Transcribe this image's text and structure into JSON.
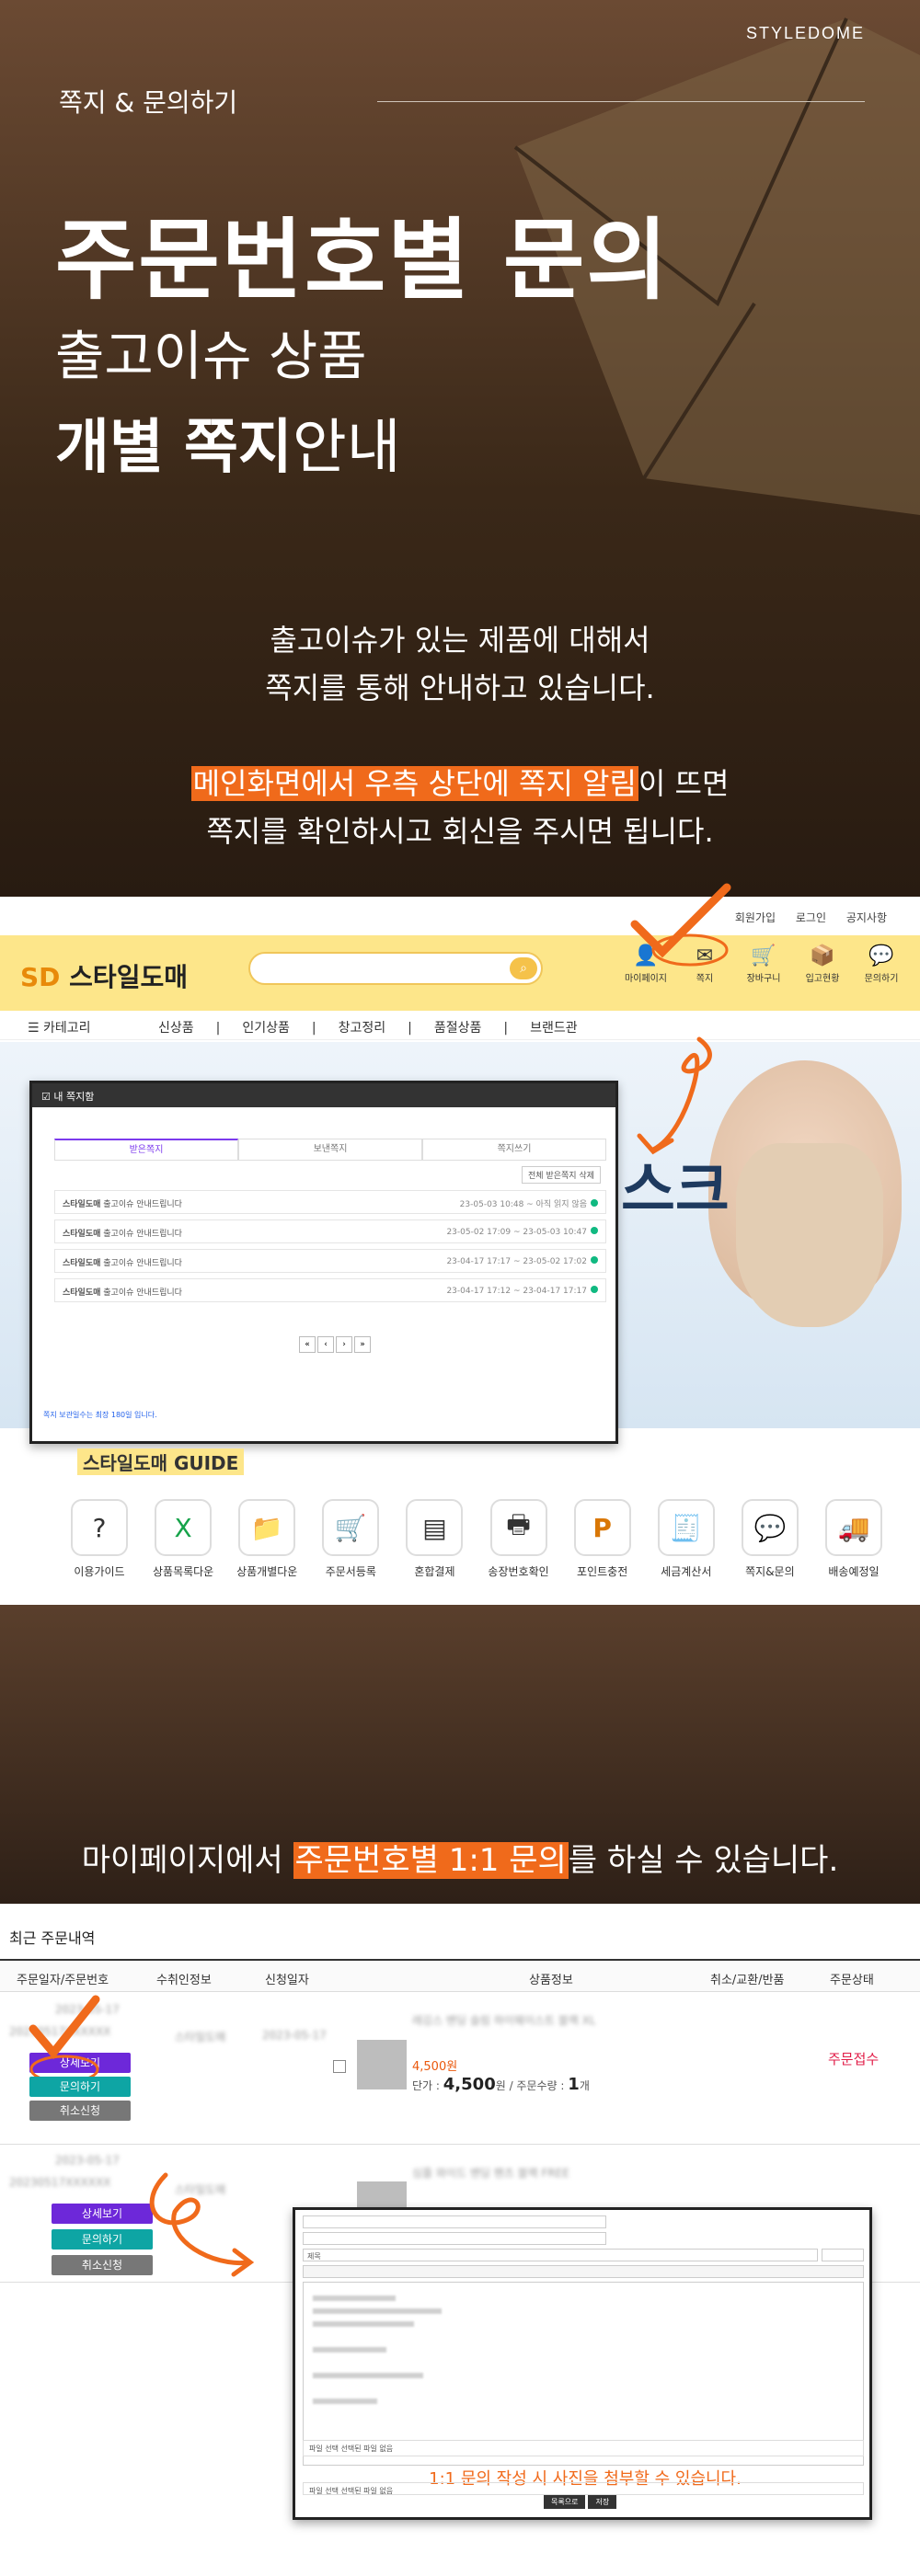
{
  "hero": {
    "brand": "STYLEDOME",
    "subheading": "쪽지 & 문의하기",
    "title": "주문번호별 문의",
    "line2": "출고이슈 상품",
    "line3_bold": "개별 쪽지",
    "line3_light": "안내",
    "desc1": "출고이슈가 있는 제품에 대해서",
    "desc2": "쪽지를 통해  안내하고 있습니다.",
    "desc3_highlight": "메인화면에서 우측 상단에 쪽지 알림",
    "desc3_rest": "이 뜨면",
    "desc4": "쪽지를 확인하시고 회신을 주시면 됩니다.",
    "accent_color": "#f06a1b"
  },
  "site": {
    "topnav": [
      "회원가입",
      "로그인",
      "공지사항"
    ],
    "logo_mark": "SD",
    "logo_text": "스타일도매",
    "header_icons": [
      {
        "icon": "user-icon",
        "glyph": "👤",
        "label": "마이페이지"
      },
      {
        "icon": "mail-icon",
        "glyph": "✉",
        "label": "쪽지"
      },
      {
        "icon": "cart-icon",
        "glyph": "🛒",
        "label": "장바구니"
      },
      {
        "icon": "box-icon",
        "glyph": "📦",
        "label": "입고현황"
      },
      {
        "icon": "chat-icon",
        "glyph": "💬",
        "label": "문의하기"
      }
    ],
    "category_label": "카테고리",
    "menu": [
      "신상품",
      "|",
      "인기상품",
      "|",
      "창고정리",
      "|",
      "품절상품",
      "|",
      "브랜드관"
    ],
    "banner_text": "스크",
    "guide_tag": "스타일도매 GUIDE",
    "guides": [
      {
        "icon": "guide-icon",
        "glyph": "?",
        "label": "이용가이드"
      },
      {
        "icon": "excel-icon",
        "glyph": "X",
        "label": "상품목록다운"
      },
      {
        "icon": "folder-icon",
        "glyph": "📁",
        "label": "상품개별다운"
      },
      {
        "icon": "cart-icon",
        "glyph": "🛒",
        "label": "주문서등록"
      },
      {
        "icon": "payment-icon",
        "glyph": "▤",
        "label": "혼합결제"
      },
      {
        "icon": "printer-icon",
        "glyph": "🖶",
        "label": "송장번호확인"
      },
      {
        "icon": "point-icon",
        "glyph": "P",
        "label": "포인트충전"
      },
      {
        "icon": "invoice-icon",
        "glyph": "🧾",
        "label": "세금계산서"
      },
      {
        "icon": "message-icon",
        "glyph": "💬",
        "label": "쪽지&문의"
      },
      {
        "icon": "delivery-icon",
        "glyph": "🚚",
        "label": "배송예정일"
      }
    ]
  },
  "modal": {
    "title": "☑ 내 쪽지함",
    "tabs": [
      "받은쪽지",
      "보낸쪽지",
      "쪽지쓰기"
    ],
    "delete_label": "전체 받은쪽지 삭제",
    "rows": [
      {
        "sender": "스타일도매",
        "msg": "출고이슈 안내드립니다",
        "date": "23-05-03 10:48 ~ 아직 읽지 않음"
      },
      {
        "sender": "스타일도매",
        "msg": "출고이슈 안내드립니다",
        "date": "23-05-02 17:09 ~ 23-05-03 10:47"
      },
      {
        "sender": "스타일도매",
        "msg": "출고이슈 안내드립니다",
        "date": "23-04-17 17:17 ~ 23-05-02 17:02"
      },
      {
        "sender": "스타일도매",
        "msg": "출고이슈 안내드립니다",
        "date": "23-04-17 17:12 ~ 23-04-17 17:17"
      }
    ],
    "pages": [
      "«",
      "‹",
      "›",
      "»"
    ],
    "footer": "쪽지 보관일수는 최장 180일 입니다."
  },
  "section2": {
    "pre": "마이페이지에서 ",
    "highlight": "주문번호별 1:1 문의",
    "post": "를 하실 수 있습니다."
  },
  "orders": {
    "title": "최근 주문내역",
    "headers": [
      "주문일자/주문번호",
      "수취인정보",
      "신청일자",
      "상품정보",
      "취소/교환/반품",
      "주문상태"
    ],
    "row1": {
      "date": "2023-05-17",
      "number": "20230517XXXXXX",
      "buttons": [
        "상세보기",
        "문의하기",
        "취소신청"
      ],
      "receiver": "스타일도매",
      "applied": "2023-05-17",
      "product": "레깅스 밴딩 슬림 하이웨이스트 블랙 XL",
      "price": "4,500원",
      "unit_label": "단가 :",
      "unit_price": "4,500",
      "unit_suffix": "원 / 주문수량 :",
      "qty": "1",
      "qty_suffix": "개",
      "status": "주문접수"
    },
    "row2": {
      "date": "2023-05-17",
      "number": "20230517XXXXXX",
      "buttons": [
        "상세보기",
        "문의하기",
        "취소신청"
      ],
      "receiver": "스타일도매",
      "product": "심플 와이드 밴딩 팬츠 블랙 FREE"
    }
  },
  "editor": {
    "subject_label": "제목",
    "attach1": "파일 선택  선택된 파일 없음",
    "attach2": "파일 선택  선택된 파일 없음",
    "note": "1:1 문의 작성 시 사진을 첨부할 수 있습니다.",
    "save": "저장",
    "list": "목록으로"
  }
}
